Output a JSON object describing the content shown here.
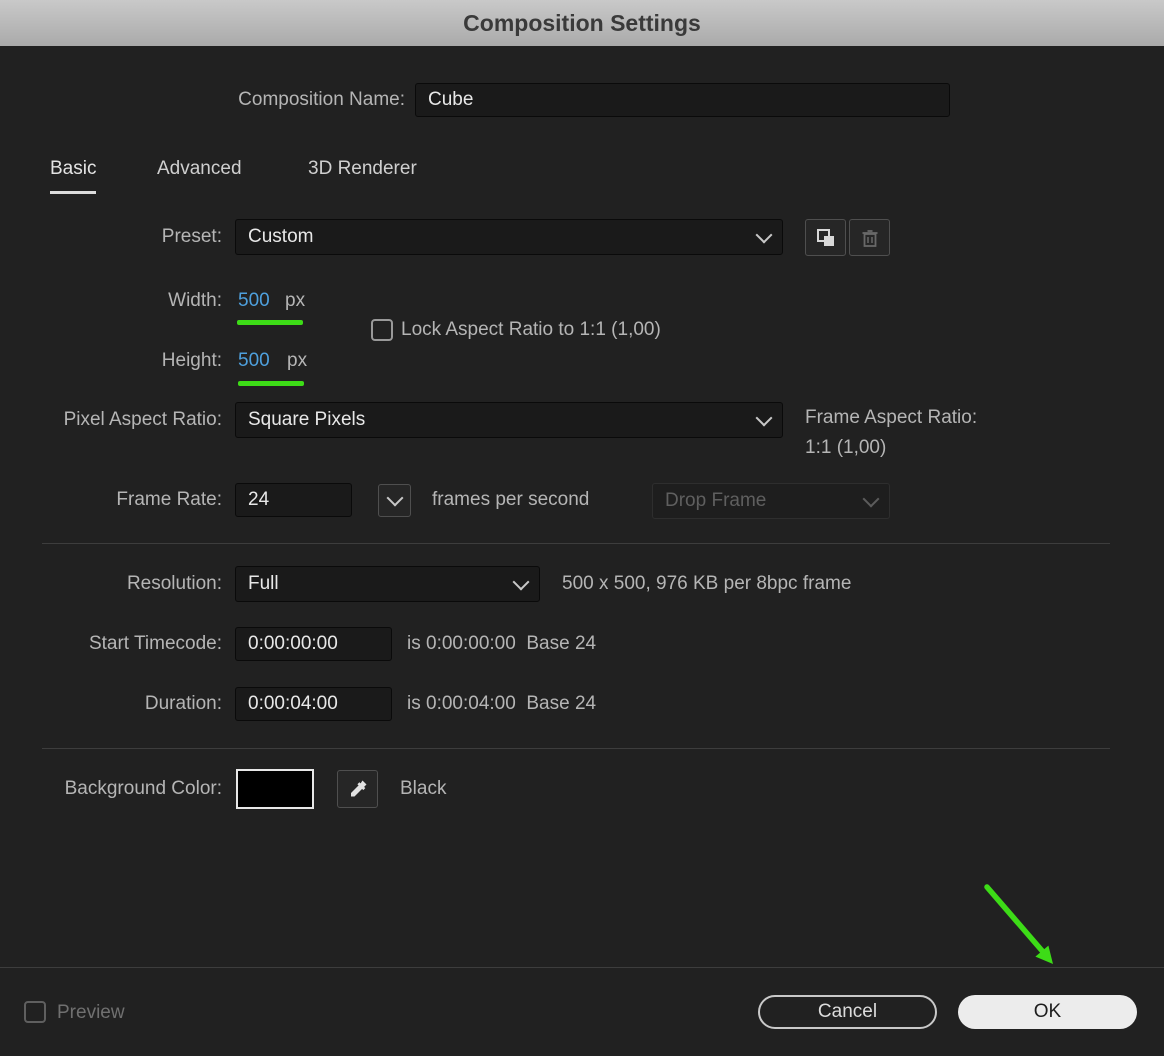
{
  "title": "Composition Settings",
  "colors": {
    "accent_blue": "#4ea0dd",
    "annotation_green": "#3ddc17",
    "swatch_black": "#000000"
  },
  "composition_name": {
    "label": "Composition Name:",
    "value": "Cube"
  },
  "tabs": {
    "basic": "Basic",
    "advanced": "Advanced",
    "renderer": "3D Renderer"
  },
  "preset": {
    "label": "Preset:",
    "value": "Custom"
  },
  "dimensions": {
    "width_label": "Width:",
    "width_value": "500",
    "width_unit": "px",
    "height_label": "Height:",
    "height_value": "500",
    "height_unit": "px",
    "lock_label": "Lock Aspect Ratio to 1:1 (1,00)",
    "lock_checked": false
  },
  "pixel_aspect_ratio": {
    "label": "Pixel Aspect Ratio:",
    "value": "Square Pixels"
  },
  "frame_aspect_ratio": {
    "label": "Frame Aspect Ratio:",
    "value": "1:1 (1,00)"
  },
  "frame_rate": {
    "label": "Frame Rate:",
    "value": "24",
    "unit": "frames per second",
    "drop_frame": "Drop Frame"
  },
  "resolution": {
    "label": "Resolution:",
    "value": "Full",
    "info": "500 x 500, 976 KB per 8bpc frame"
  },
  "start_timecode": {
    "label": "Start Timecode:",
    "value": "0:00:00:00",
    "info": "is 0:00:00:00  Base 24"
  },
  "duration": {
    "label": "Duration:",
    "value": "0:00:04:00",
    "info": "is 0:00:04:00  Base 24"
  },
  "background_color": {
    "label": "Background Color:",
    "name": "Black"
  },
  "footer": {
    "preview": "Preview",
    "cancel": "Cancel",
    "ok": "OK"
  }
}
